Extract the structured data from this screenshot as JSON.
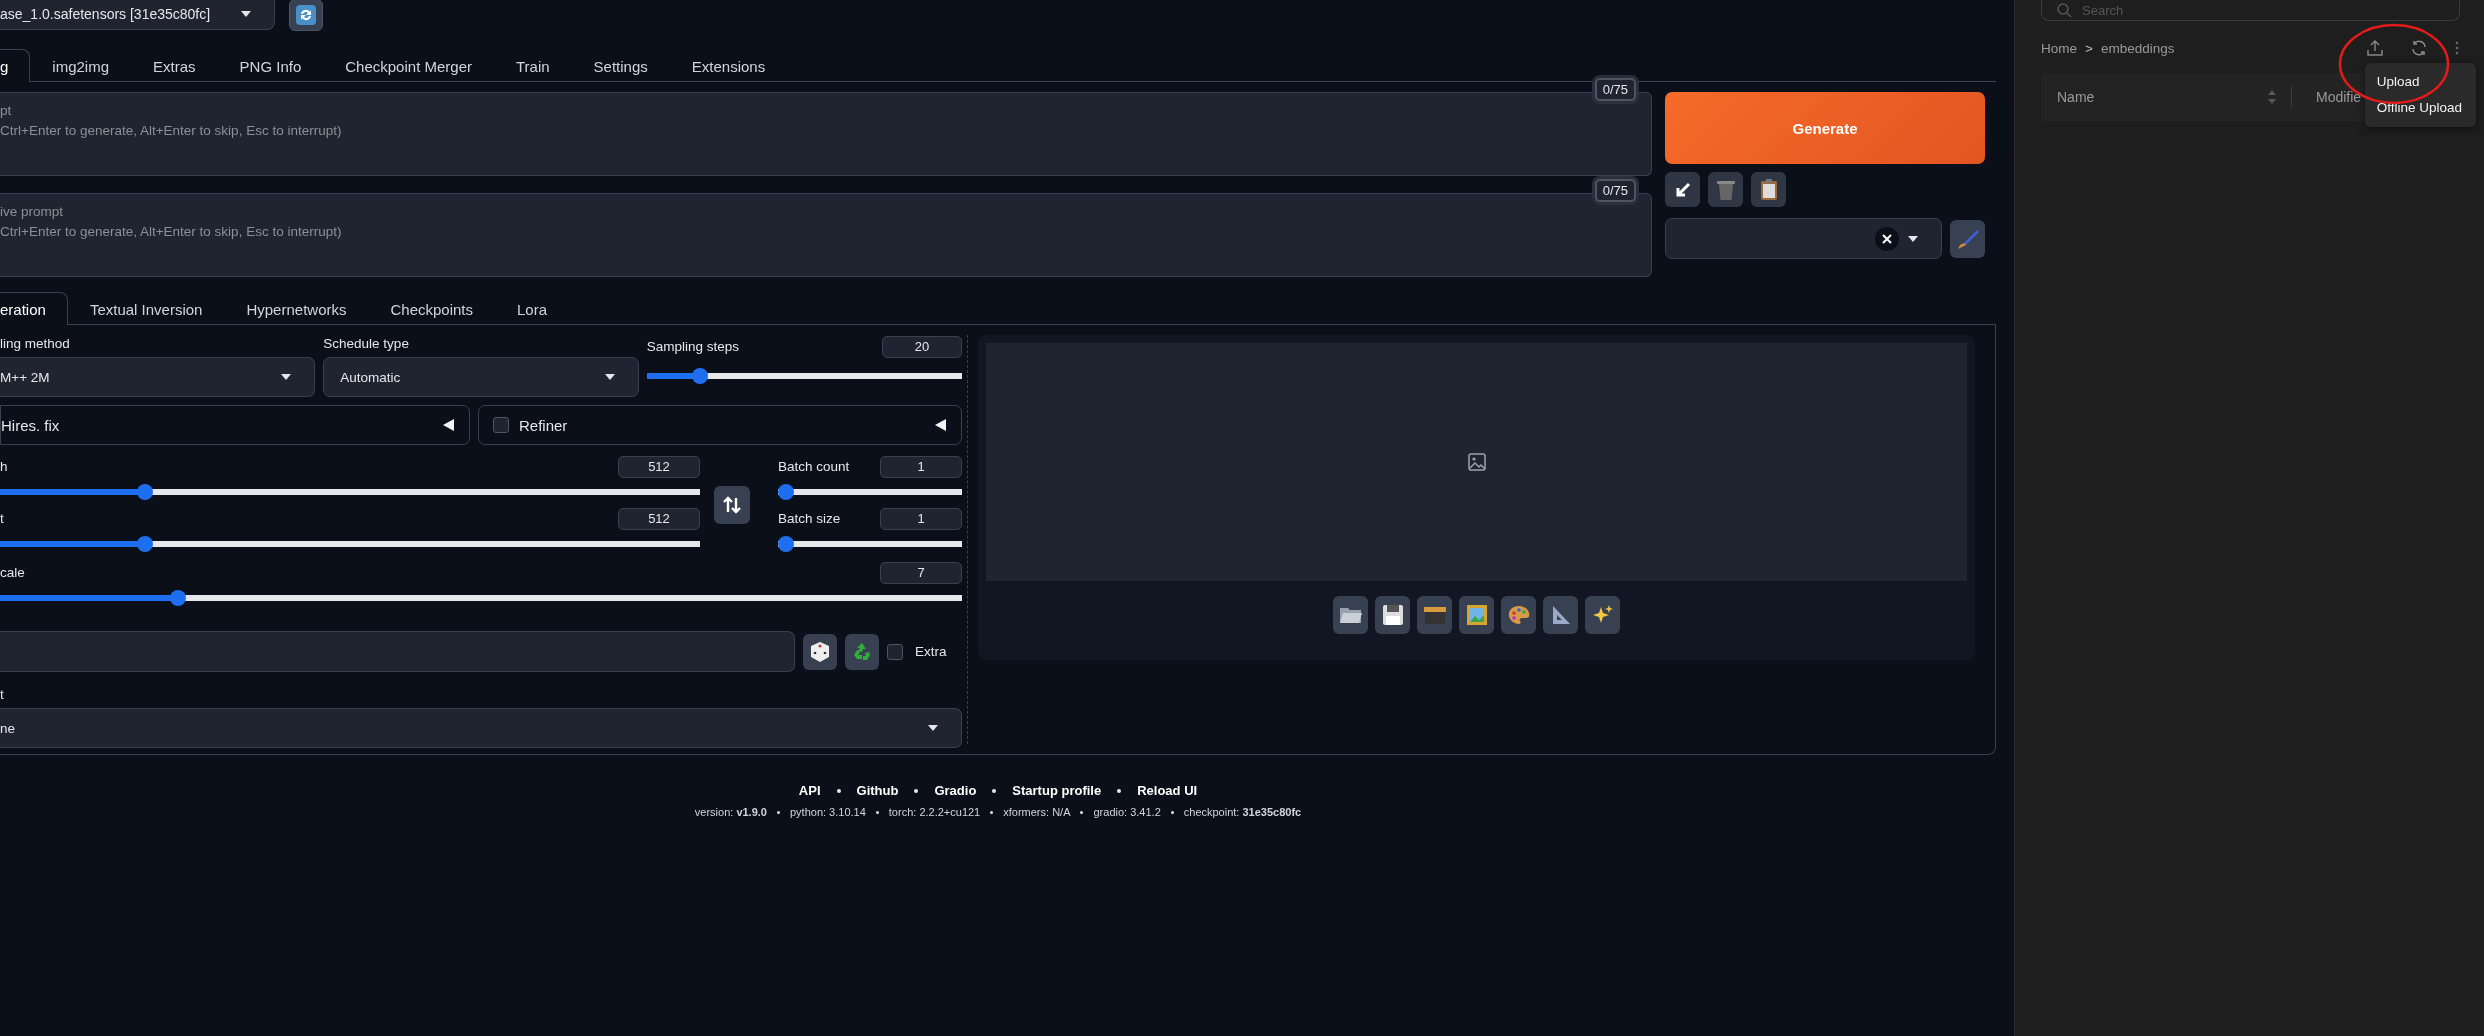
{
  "model_select": {
    "value": "ase_1.0.safetensors [31e35c80fc]"
  },
  "tabs": [
    {
      "label": "g",
      "selected": true
    },
    {
      "label": "img2img",
      "selected": false
    },
    {
      "label": "Extras",
      "selected": false
    },
    {
      "label": "PNG Info",
      "selected": false
    },
    {
      "label": "Checkpoint Merger",
      "selected": false
    },
    {
      "label": "Train",
      "selected": false
    },
    {
      "label": "Settings",
      "selected": false
    },
    {
      "label": "Extensions",
      "selected": false
    }
  ],
  "prompt": {
    "placeholder": "pt\nCtrl+Enter to generate, Alt+Enter to skip, Esc to interrupt)",
    "token_counter": "0/75"
  },
  "negative_prompt": {
    "placeholder": "ive prompt\nCtrl+Enter to generate, Alt+Enter to skip, Esc to interrupt)",
    "token_counter": "0/75"
  },
  "generate_button": "Generate",
  "subtabs": [
    {
      "label": "eration",
      "selected": true
    },
    {
      "label": "Textual Inversion",
      "selected": false
    },
    {
      "label": "Hypernetworks",
      "selected": false
    },
    {
      "label": "Checkpoints",
      "selected": false
    },
    {
      "label": "Lora",
      "selected": false
    }
  ],
  "sampling_method": {
    "label": "ling method",
    "value": "M++ 2M"
  },
  "schedule_type": {
    "label": "Schedule type",
    "value": "Automatic"
  },
  "sampling_steps": {
    "label": "Sampling steps",
    "value": "20",
    "level": 0.15
  },
  "hires_fix": {
    "label": "Hires. fix",
    "expanded": false
  },
  "refiner": {
    "label": "Refiner",
    "checked": false,
    "expanded": false
  },
  "width": {
    "label": "h",
    "value": "512",
    "level": 0.2
  },
  "height": {
    "label": "t",
    "value": "512",
    "level": 0.2
  },
  "batch_count": {
    "label": "Batch count",
    "value": "1",
    "level": 0
  },
  "batch_size": {
    "label": "Batch size",
    "value": "1",
    "level": 0
  },
  "cfg_scale": {
    "label": "cale",
    "value": "7",
    "level": 0.18
  },
  "extra": {
    "label": "Extra",
    "checked": false
  },
  "script": {
    "label": "t",
    "value": "ne"
  },
  "footer": {
    "links": [
      "API",
      "Github",
      "Gradio",
      "Startup profile",
      "Reload UI"
    ],
    "versions": [
      "version: **v1.9.0**",
      "python: 3.10.14",
      "torch: 2.2.2+cu121",
      "xformers: N/A",
      "gradio: 3.41.2",
      "checkpoint: **31e35c80fc**"
    ]
  },
  "file_panel": {
    "search": {
      "placeholder": "Search"
    },
    "breadcrumb": [
      "Home",
      "embeddings"
    ],
    "breadcrumb_separator": ">",
    "columns": [
      "Name",
      "Modifie"
    ],
    "menu": [
      {
        "label": "Upload"
      },
      {
        "label": "Offline Upload"
      }
    ]
  }
}
